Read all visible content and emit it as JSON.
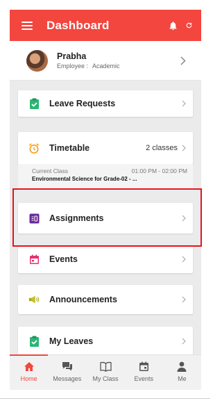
{
  "app_bar": {
    "title": "Dashboard",
    "menu_icon": "hamburger-icon",
    "notification_icon": "bell-icon",
    "refresh_icon": "refresh-icon"
  },
  "profile": {
    "name": "Prabha",
    "role_label": "Employee :",
    "role_value": "Academic"
  },
  "cards": {
    "leave_requests": "Leave Requests",
    "timetable": "Timetable",
    "timetable_count": "2 classes",
    "assignments": "Assignments",
    "events": "Events",
    "announcements": "Announcements",
    "my_leaves": "My Leaves"
  },
  "current_class": {
    "label": "Current Class",
    "time": "01:00 PM - 02:00 PM",
    "subject": "Environmental Science for Grade-02 - ..."
  },
  "tabs": [
    {
      "label": "Home",
      "icon": "home-icon"
    },
    {
      "label": "Messages",
      "icon": "messages-icon"
    },
    {
      "label": "My Class",
      "icon": "book-icon"
    },
    {
      "label": "Events",
      "icon": "calendar-icon"
    },
    {
      "label": "Me",
      "icon": "person-icon"
    }
  ],
  "colors": {
    "primary": "#f2463f",
    "highlight": "#e8121f",
    "green": "#2bb673",
    "orange": "#f4a01c",
    "purple": "#6a2a9b",
    "pink": "#e8306f",
    "olive": "#a7a51e"
  }
}
